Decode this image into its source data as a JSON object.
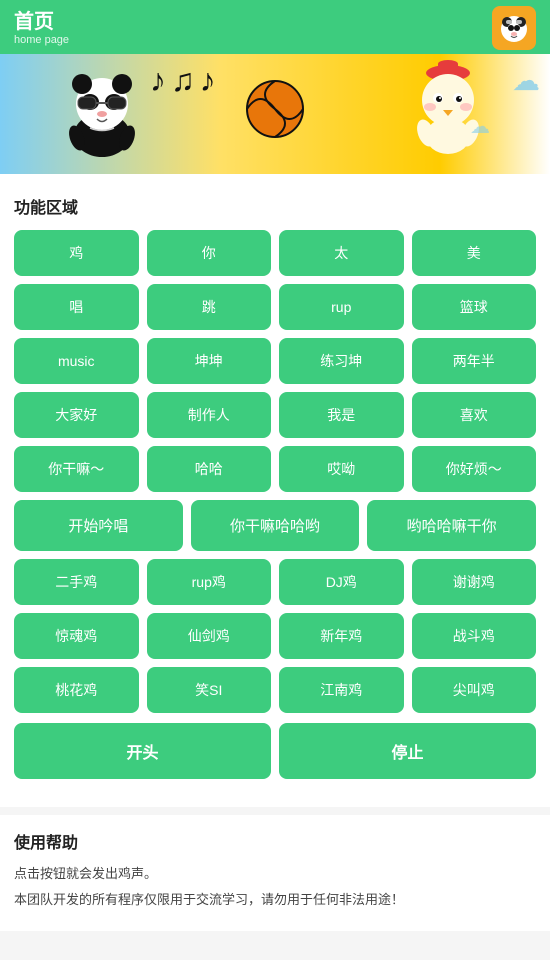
{
  "header": {
    "title_zh": "首页",
    "title_en": "home page",
    "logo_emoji": "🐼"
  },
  "banner": {
    "panda_emoji": "🐼",
    "notes_emoji": "🎵🎵🎵",
    "basketball_emoji": "🏀",
    "chick_emoji": "🐔"
  },
  "functional_area": {
    "title": "功能区域",
    "rows": [
      [
        "鸡",
        "你",
        "太",
        "美"
      ],
      [
        "唱",
        "跳",
        "rup",
        "篮球"
      ],
      [
        "music",
        "坤坤",
        "练习坤",
        "两年半"
      ],
      [
        "大家好",
        "制作人",
        "我是",
        "喜欢"
      ],
      [
        "你干嘛～",
        "哈哈",
        "哎呦",
        "你好烦～"
      ],
      [
        "开始吟唱",
        "你干嘛哈哈哟",
        "哟哈哈嘛干你"
      ],
      [
        "二手鸡",
        "rup鸡",
        "DJ鸡",
        "谢谢鸡"
      ],
      [
        "惊魂鸡",
        "仙剑鸡",
        "新年鸡",
        "战斗鸡"
      ],
      [
        "桃花鸡",
        "笑SI",
        "江南鸡",
        "尖叫鸡"
      ]
    ],
    "action_buttons": [
      "开头",
      "停止"
    ]
  },
  "help": {
    "title": "使用帮助",
    "lines": [
      "点击按钮就会发出鸡声。",
      "本团队开发的所有程序仅限用于交流学习，请勿用于任何非法用途！"
    ]
  }
}
